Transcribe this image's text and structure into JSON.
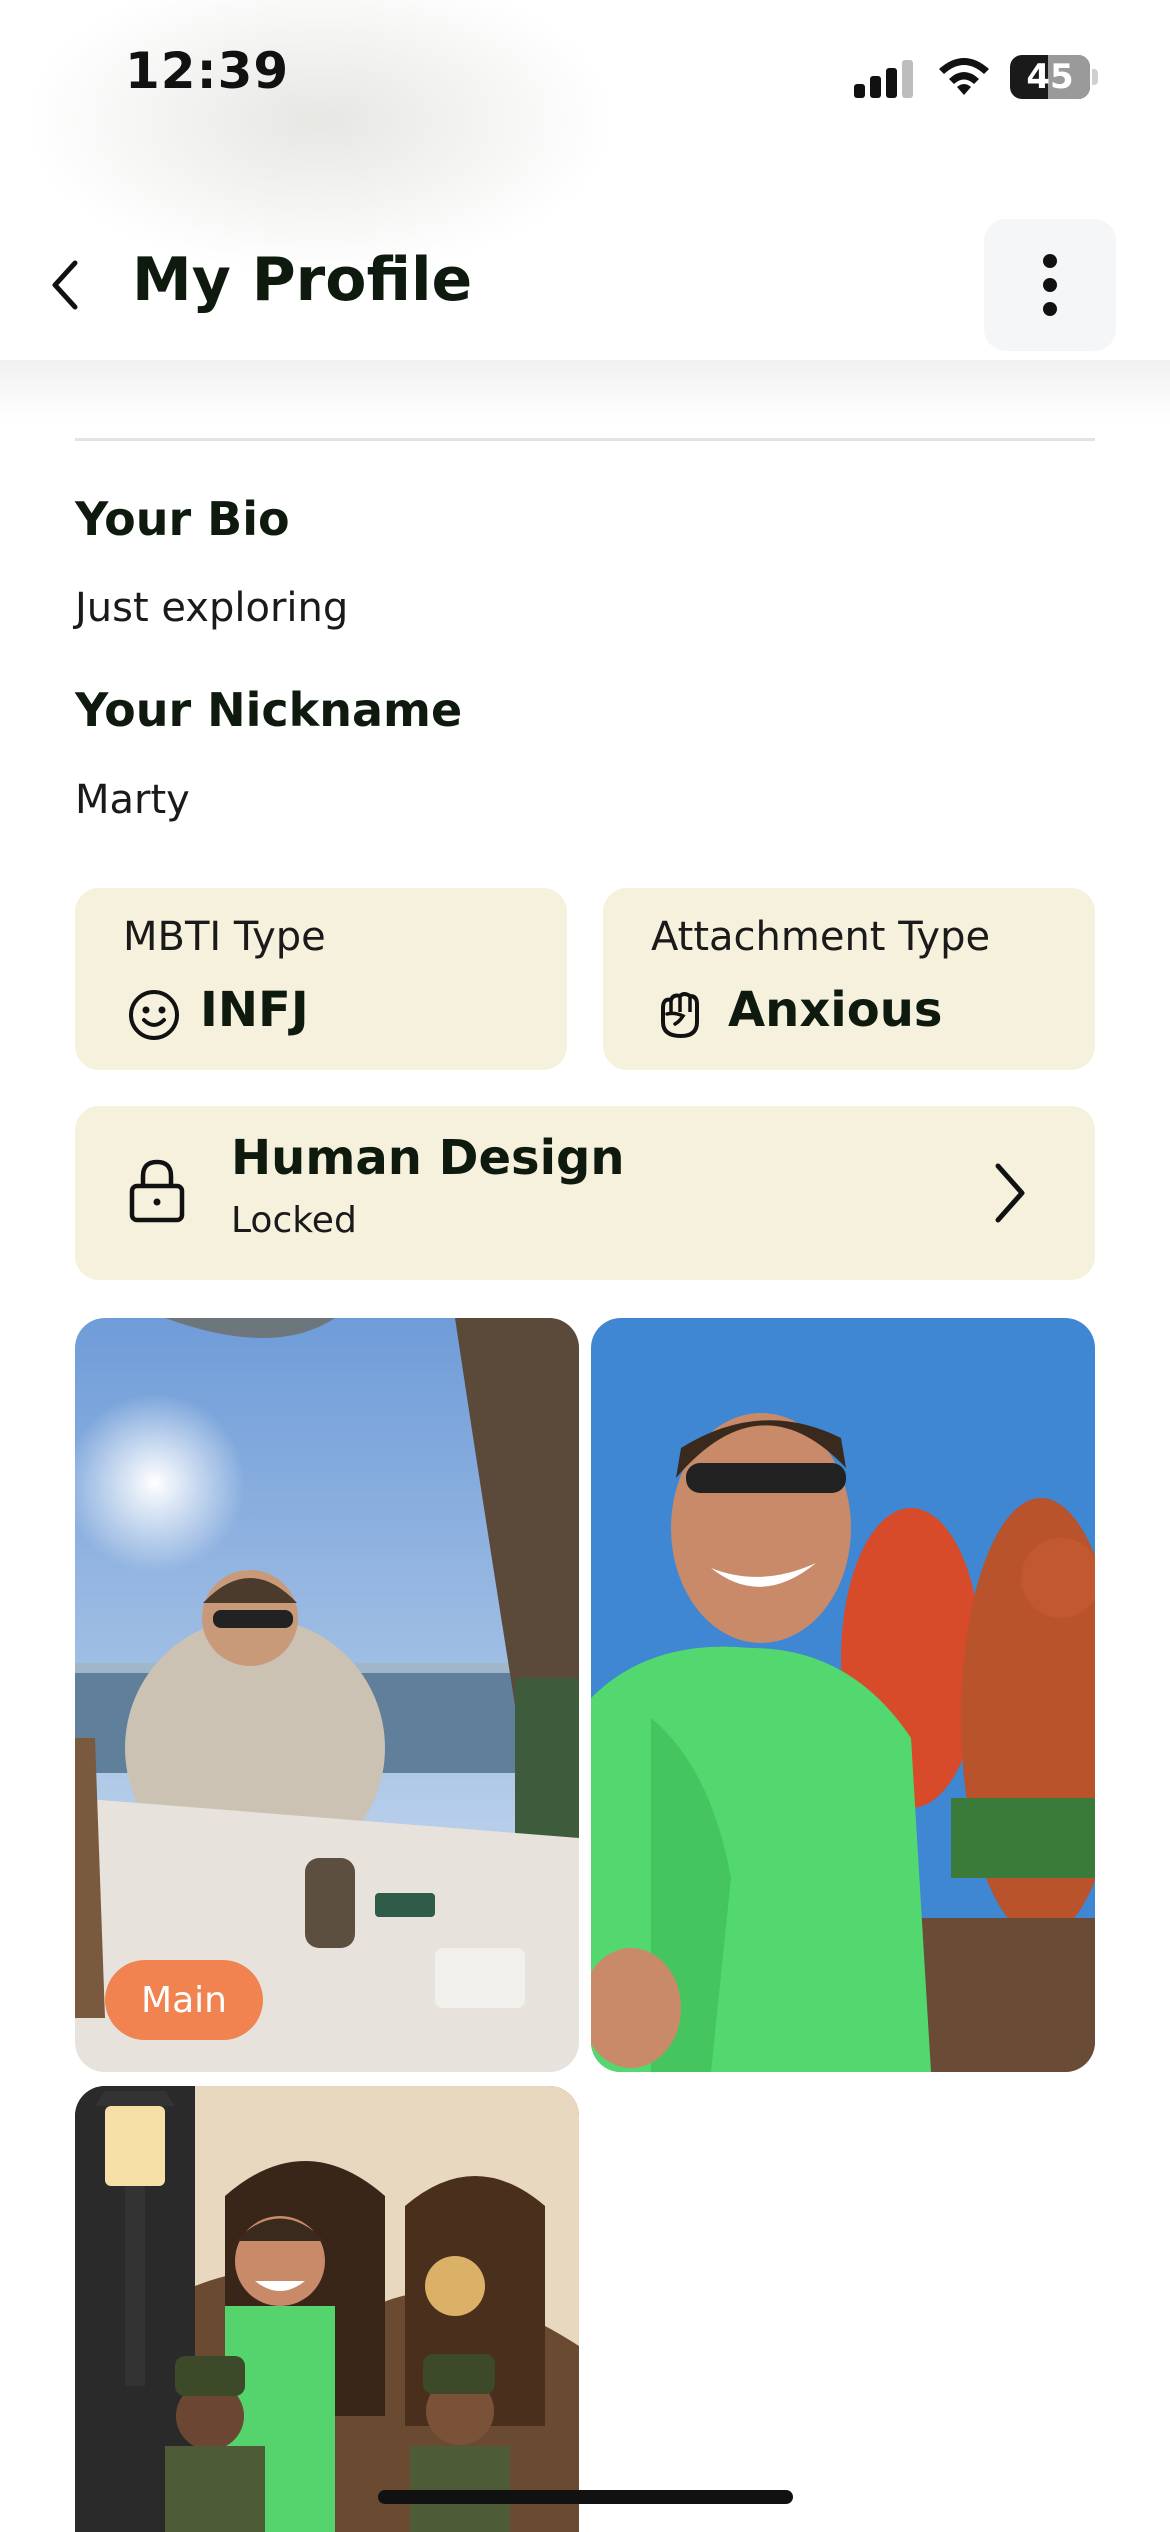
{
  "status_bar": {
    "time": "12:39",
    "battery": "45",
    "icons": [
      "cellular-signal-icon",
      "wifi-icon",
      "battery-icon"
    ]
  },
  "header": {
    "title": "My Profile",
    "back_icon": "chevron-left-icon",
    "more_icon": "more-vertical-icon"
  },
  "bio": {
    "label": "Your Bio",
    "value": "Just exploring"
  },
  "nickname": {
    "label": "Your Nickname",
    "value": "Marty"
  },
  "mbti": {
    "label": "MBTI Type",
    "value": "INFJ",
    "icon": "smiley-face-icon"
  },
  "attachment": {
    "label": "Attachment Type",
    "value": "Anxious",
    "icon": "fist-icon"
  },
  "human_design": {
    "title": "Human Design",
    "status": "Locked",
    "icon": "lock-icon",
    "chevron": "chevron-right-icon"
  },
  "photos": {
    "main_badge": "Main"
  },
  "colors": {
    "card_background": "#f5f1dc",
    "main_badge": "#f0834f",
    "text_primary": "#0f1a0f"
  }
}
